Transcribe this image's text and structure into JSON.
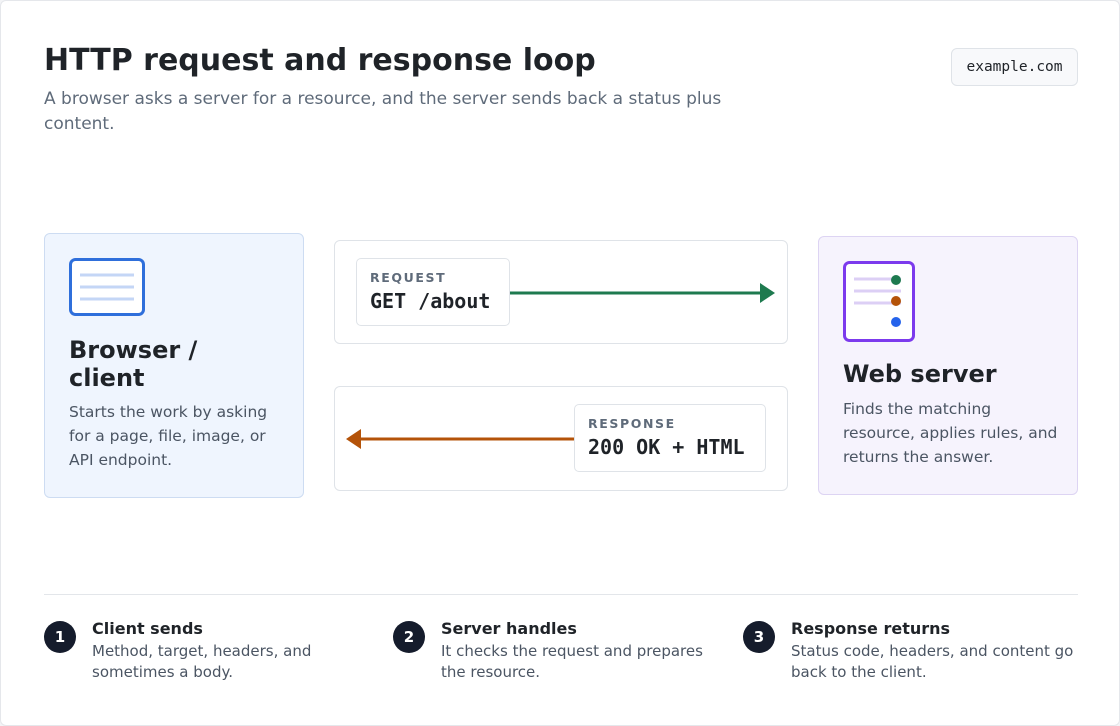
{
  "header": {
    "title": "HTTP request and response loop",
    "subtitle": "A browser asks a server for a resource, and the server sends back a status plus content.",
    "domain": "example.com"
  },
  "client": {
    "heading": "Browser / client",
    "description": "Starts the work by asking for a page, file, image, or API endpoint.",
    "icon": "document-icon",
    "accent": "#2f6fdb"
  },
  "server": {
    "heading": "Web server",
    "description": "Finds the matching resource, applies rules, and returns the answer.",
    "icon": "server-icon",
    "accent": "#7c3aed",
    "indicator_colors": [
      "#1e7a4f",
      "#b45309",
      "#2563eb"
    ]
  },
  "request": {
    "kicker": "REQUEST",
    "value": "GET /about",
    "color": "#1e7a4f"
  },
  "response": {
    "kicker": "RESPONSE",
    "value": "200 OK + HTML",
    "color": "#b45309"
  },
  "steps": [
    {
      "number": "1",
      "title": "Client sends",
      "text": "Method, target, headers, and sometimes a body."
    },
    {
      "number": "2",
      "title": "Server handles",
      "text": "It checks the request and prepares the resource."
    },
    {
      "number": "3",
      "title": "Response returns",
      "text": "Status code, headers, and content go back to the client."
    }
  ]
}
